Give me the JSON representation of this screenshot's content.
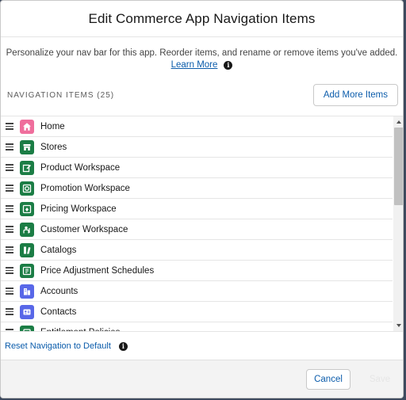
{
  "modal": {
    "title": "Edit Commerce App Navigation Items",
    "description": "Personalize your nav bar for this app. Reorder items, and rename or remove items you've added.",
    "learn_more": "Learn More",
    "info_glyph": "i"
  },
  "section": {
    "label": "NAVIGATION ITEMS (25)",
    "add_more": "Add More Items"
  },
  "items": [
    {
      "label": "Home",
      "icon": "home-icon",
      "color": "#ef6e9c"
    },
    {
      "label": "Stores",
      "icon": "store-icon",
      "color": "#1b7d45"
    },
    {
      "label": "Product Workspace",
      "icon": "product-workspace-icon",
      "color": "#1b7d45"
    },
    {
      "label": "Promotion Workspace",
      "icon": "promotion-workspace-icon",
      "color": "#1b7d45"
    },
    {
      "label": "Pricing Workspace",
      "icon": "pricing-workspace-icon",
      "color": "#1b7d45"
    },
    {
      "label": "Customer Workspace",
      "icon": "customer-workspace-icon",
      "color": "#1b7d45"
    },
    {
      "label": "Catalogs",
      "icon": "catalog-icon",
      "color": "#1b7d45"
    },
    {
      "label": "Price Adjustment Schedules",
      "icon": "price-adjustment-icon",
      "color": "#1b7d45"
    },
    {
      "label": "Accounts",
      "icon": "account-icon",
      "color": "#5867e8"
    },
    {
      "label": "Contacts",
      "icon": "contact-icon",
      "color": "#5867e8"
    },
    {
      "label": "Entitlement Policies",
      "icon": "entitlement-icon",
      "color": "#1b7d45"
    }
  ],
  "reset": {
    "label": "Reset Navigation to Default",
    "info_glyph": "i"
  },
  "footer": {
    "cancel": "Cancel",
    "save": "Save"
  },
  "colors": {
    "link": "#0b5cab",
    "home_icon_bg": "#ef6e9c",
    "commerce_icon_bg": "#1b7d45",
    "standard_icon_bg": "#5867e8"
  }
}
